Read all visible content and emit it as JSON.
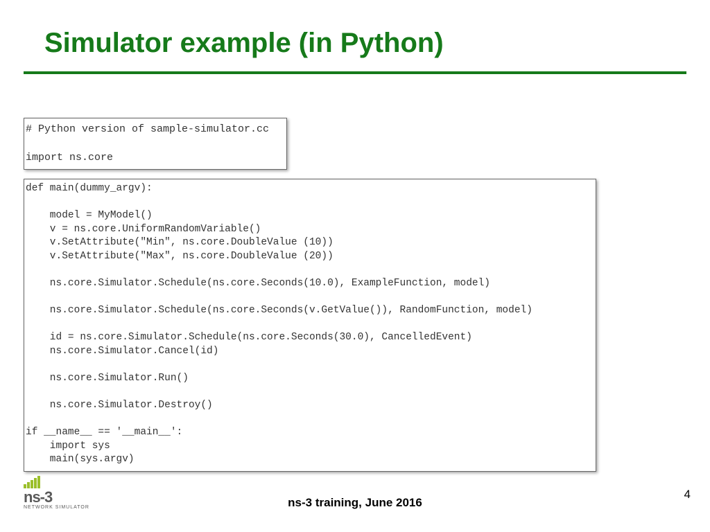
{
  "title": "Simulator example (in Python)",
  "code_block_1": "# Python version of sample-simulator.cc\n\nimport ns.core",
  "code_block_2": "def main(dummy_argv):\n\n    model = MyModel()\n    v = ns.core.UniformRandomVariable()\n    v.SetAttribute(\"Min\", ns.core.DoubleValue (10))\n    v.SetAttribute(\"Max\", ns.core.DoubleValue (20))\n\n    ns.core.Simulator.Schedule(ns.core.Seconds(10.0), ExampleFunction, model)\n\n    ns.core.Simulator.Schedule(ns.core.Seconds(v.GetValue()), RandomFunction, model)\n\n    id = ns.core.Simulator.Schedule(ns.core.Seconds(30.0), CancelledEvent)\n    ns.core.Simulator.Cancel(id)\n\n    ns.core.Simulator.Run()\n\n    ns.core.Simulator.Destroy()\n\nif __name__ == '__main__':\n    import sys\n    main(sys.argv)",
  "footer": {
    "center": "ns-3 training, June 2016",
    "page": "4"
  },
  "logo": {
    "brand": "ns-3",
    "subtitle": "NETWORK SIMULATOR"
  }
}
